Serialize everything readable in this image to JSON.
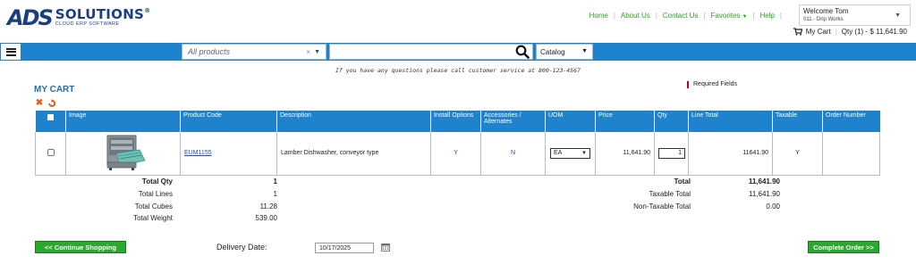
{
  "header": {
    "logo_mark": "ADS",
    "logo_name": "SOLUTIONS",
    "logo_reg": "®",
    "logo_sub": "CLOUD ERP SOFTWARE",
    "nav": {
      "home": "Home",
      "about": "About Us",
      "contact": "Contact Us",
      "favorites": "Favorites",
      "help": "Help"
    },
    "welcome": {
      "line1": "Welcome Tom",
      "line2": "011 - Drip Works"
    },
    "cart": {
      "label": "My Cart",
      "summary": "Qty (1) - $ 11,641.90"
    }
  },
  "searchbar": {
    "product_scope": "All products",
    "search_value": "",
    "catalog": "Catalog"
  },
  "notice": "If you have any questions please call customer service at 800-123-4567",
  "page": {
    "title": "MY CART",
    "required_note": "Required Fields"
  },
  "table": {
    "columns": [
      "Image",
      "Product Code",
      "Description",
      "Install Options",
      "Accessories / Alternates",
      "UOM",
      "Price",
      "Qty",
      "Line Total",
      "Taxable",
      "Order Number"
    ],
    "rows": [
      {
        "image_icon": "dishwasher-product-image",
        "product_code": "EUM1155",
        "description": "Lamber Dishwasher, conveyor type",
        "install_options": "Y",
        "accessories": "N",
        "uom": "EA",
        "price": "11,641.90",
        "qty": "1",
        "line_total": "11641.90",
        "taxable": "Y",
        "order_number": ""
      }
    ]
  },
  "summary_left": [
    {
      "label": "Total Qty",
      "value": "1"
    },
    {
      "label": "Total Lines",
      "value": "1"
    },
    {
      "label": "Total Cubes",
      "value": "11.28"
    },
    {
      "label": "Total Weight",
      "value": "539.00"
    }
  ],
  "summary_right": [
    {
      "label": "Total",
      "value": "11,641.90"
    },
    {
      "label": "Taxable Total",
      "value": "11,641.90"
    },
    {
      "label": "Non-Taxable Total",
      "value": "0.00"
    }
  ],
  "footer": {
    "continue_label": "<< Continue Shopping",
    "delivery_label": "Delivery Date:",
    "delivery_value": "10/17/2025",
    "complete_label": "Complete Order >>"
  },
  "colors": {
    "brand_blue": "#1f82cd",
    "accent_green": "#2ba82e",
    "nav_green": "#28a61a",
    "logo_navy": "#1b3f80",
    "icon_orange": "#e85a1a"
  }
}
